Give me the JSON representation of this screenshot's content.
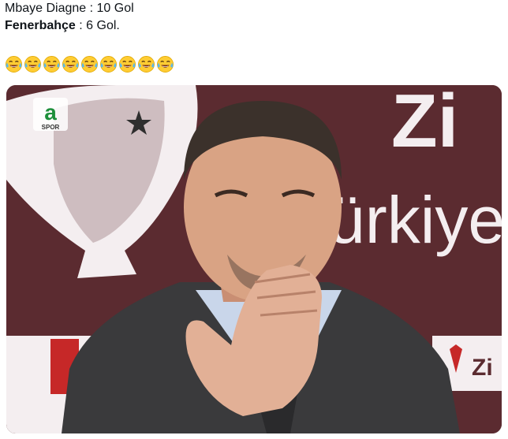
{
  "tweet": {
    "line1": "Mbaye Diagne : 10 Gol",
    "line2_name": "Fenerbahçe",
    "line2_rest": " : 6 Gol.",
    "emoji_count": 9,
    "emoji_name": "face-with-tears-of-joy-icon"
  },
  "photo": {
    "channel_logo_letter": "a",
    "channel_logo_sub": "SPOR",
    "backdrop_text_top": "Zi",
    "backdrop_text_main": "ürkiye",
    "sponsor_text": "Zi",
    "colors": {
      "backdrop": "#5b2b30",
      "suit": "#3a3a3c",
      "shirt": "#c9d6ea",
      "skin": "#d9a384"
    }
  }
}
